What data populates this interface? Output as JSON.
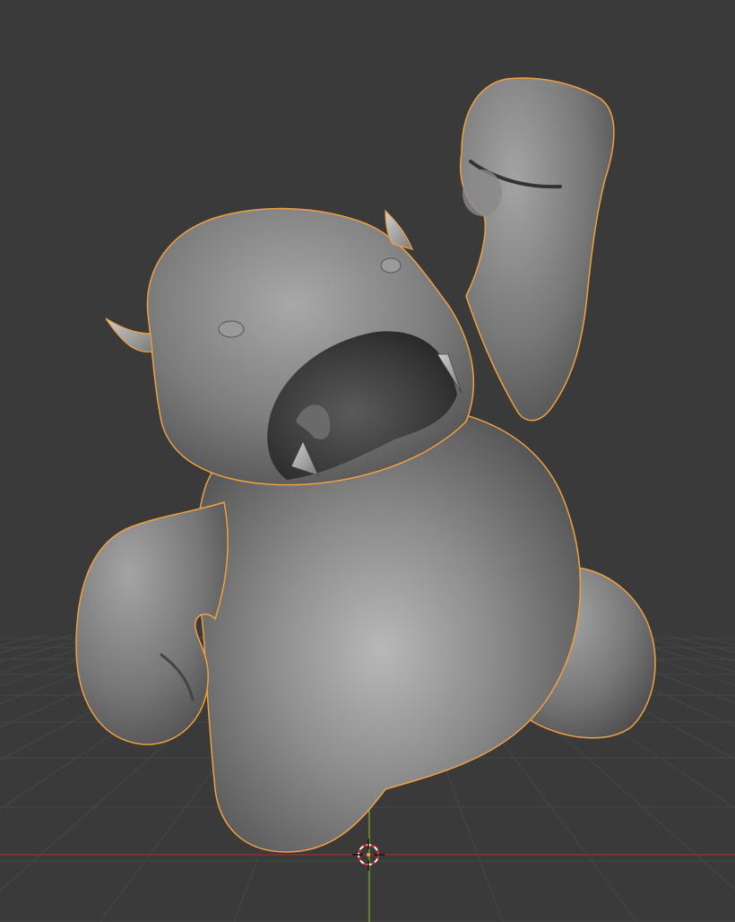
{
  "viewport": {
    "background_color": "#3a3a3a",
    "grid_line_color": "#474747",
    "x_axis_color": "#8a2e3b",
    "y_axis_color": "#6d9a1f",
    "selection_outline_color": "#f0a040",
    "model_base_color": "#7a7a7a",
    "3d_cursor_colors": [
      "#ff2020",
      "#ffffff"
    ],
    "icons": [
      "3d-cursor-icon"
    ]
  }
}
